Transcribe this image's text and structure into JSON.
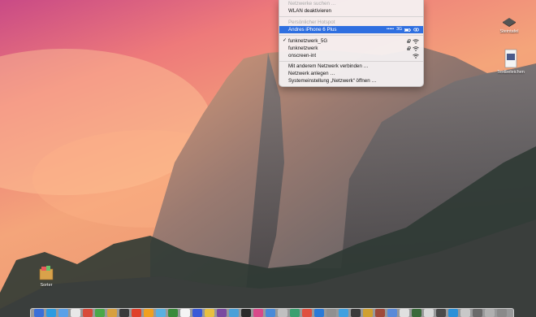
{
  "wifi_menu": {
    "search_label": "Netzwerke suchen …",
    "toggle_label": "WLAN deaktivieren",
    "hotspot_header": "Persönlicher Hotspot",
    "hotspot": {
      "name": "Andres iPhone 6 Plus",
      "signal": "•••••",
      "network_type": "3G"
    },
    "networks": [
      {
        "name": "funknetzwerk_5G",
        "checked": true,
        "secured": true
      },
      {
        "name": "funknetzwerk",
        "checked": false,
        "secured": true
      },
      {
        "name": "onscreen-int",
        "checked": false,
        "secured": false
      }
    ],
    "actions": [
      "Mit anderem Netzwerk verbinden …",
      "Netzwerk anlegen …",
      "Systemeinstellung „Netzwerk“ öffnen …"
    ]
  },
  "desktop": {
    "icons": [
      {
        "label": "Steintafel",
        "icon": "tablet-icon"
      },
      {
        "label": "Textbeleichen",
        "icon": "document-icon"
      },
      {
        "label": "Sorter",
        "icon": "folder-icon"
      }
    ]
  },
  "dock": {
    "app_colors": [
      "#3a6fd8",
      "#2d9be0",
      "#5aa0e8",
      "#e8e8e8",
      "#d84a3a",
      "#4aa84a",
      "#d8a040",
      "#3a3a3a",
      "#e0402a",
      "#f0a020",
      "#5ab0e0",
      "#3a8a3a",
      "#f4f4f4",
      "#3a5ad8",
      "#e8c040",
      "#7a4aa0",
      "#4aa0d8",
      "#2a2a2a",
      "#d84a8a",
      "#4a8ad8",
      "#c0c0c0",
      "#3aa070",
      "#e05040",
      "#2a7ad8",
      "#909090",
      "#40a0e0",
      "#3a3a3a",
      "#d0a030",
      "#a04a3a",
      "#5a8ad8",
      "#e0e0e0",
      "#3a6a3a",
      "#d8d8d8",
      "#4a4a4a",
      "#2a90d8",
      "#c8c8c8",
      "#6a6a6a",
      "#b0b0b0",
      "#8a8a8a"
    ]
  },
  "colors": {
    "selection": "#2f6fe0",
    "menu_bg": "#f4f1f2"
  }
}
